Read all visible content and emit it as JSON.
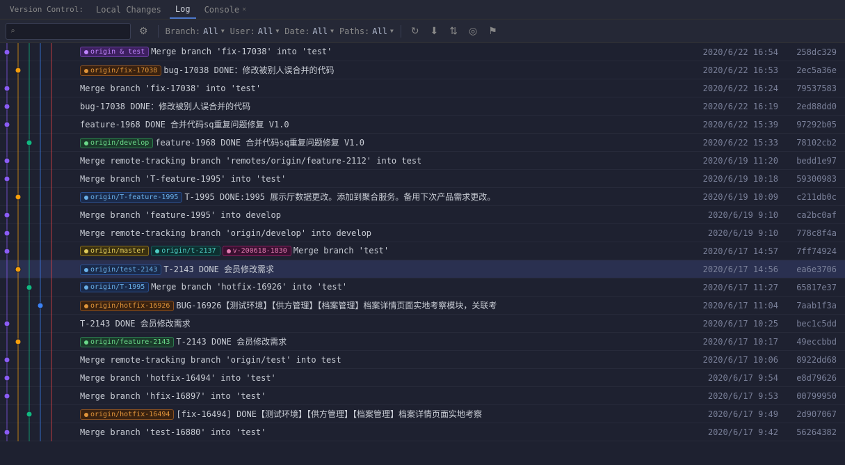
{
  "tabbar": {
    "version_control_label": "Version Control:",
    "local_changes_tab": "Local Changes",
    "log_tab": "Log",
    "console_tab": "Console"
  },
  "toolbar": {
    "search_placeholder": "⌕",
    "branch_label": "Branch:",
    "branch_value": "All",
    "user_label": "User:",
    "user_value": "All",
    "date_label": "Date:",
    "date_value": "All",
    "paths_label": "Paths:",
    "paths_value": "All"
  },
  "commits": [
    {
      "id": "258dc329",
      "date": "2020/6/22 16:54",
      "message": "Merge branch 'fix-17038' into 'test'",
      "tags": [
        {
          "label": "origin & test",
          "type": "purple"
        },
        {
          "label": "",
          "type": ""
        }
      ],
      "graph_col": 1,
      "selected": false
    },
    {
      "id": "2ec5a36e",
      "date": "2020/6/22 16:53",
      "message": "bug-17038 DONE：修改被别人误合并的代码",
      "tags": [
        {
          "label": "origin/fix-17038",
          "type": "orange"
        }
      ],
      "graph_col": 2,
      "selected": false
    },
    {
      "id": "79537583",
      "date": "2020/6/22 16:24",
      "message": "Merge branch 'fix-17038' into 'test'",
      "tags": [],
      "graph_col": 1,
      "selected": false
    },
    {
      "id": "2ed88dd0",
      "date": "2020/6/22 16:19",
      "message": "bug-17038 DONE：修改被别人误合并的代码",
      "tags": [],
      "graph_col": 1,
      "selected": false
    },
    {
      "id": "97292b05",
      "date": "2020/6/22 15:39",
      "message": "feature-1968 DONE  合并代码sq重复问题修复 V1.0",
      "tags": [],
      "graph_col": 1,
      "selected": false
    },
    {
      "id": "78102cb2",
      "date": "2020/6/22 15:33",
      "message": "feature-1968 DONE  合并代码sq重复问题修复 V1.0",
      "tags": [
        {
          "label": "origin/develop",
          "type": "green"
        }
      ],
      "graph_col": 3,
      "selected": false
    },
    {
      "id": "bedd1e97",
      "date": "2020/6/19 11:20",
      "message": "Merge remote-tracking branch 'remotes/origin/feature-2112' into test",
      "tags": [],
      "graph_col": 1,
      "selected": false
    },
    {
      "id": "59300983",
      "date": "2020/6/19 10:18",
      "message": "Merge branch 'T-feature-1995' into 'test'",
      "tags": [],
      "graph_col": 1,
      "selected": false
    },
    {
      "id": "c211db0c",
      "date": "2020/6/19 10:09",
      "message": "T-1995 DONE:1995 展示厅数据更改。添加到聚合服务。备用下次产品需求更改。",
      "tags": [
        {
          "label": "origin/T-feature-1995",
          "type": "blue"
        }
      ],
      "graph_col": 2,
      "selected": false
    },
    {
      "id": "ca2bc0af",
      "date": "2020/6/19 9:10",
      "message": "Merge branch 'feature-1995' into develop",
      "tags": [],
      "graph_col": 1,
      "selected": false
    },
    {
      "id": "778c8f4a",
      "date": "2020/6/19 9:10",
      "message": "Merge remote-tracking branch 'origin/develop' into develop",
      "tags": [],
      "graph_col": 1,
      "selected": false
    },
    {
      "id": "7ff74924",
      "date": "2020/6/17 14:57",
      "message": "Merge branch 'test'",
      "tags": [
        {
          "label": "origin/master",
          "type": "yellow"
        },
        {
          "label": "origin/t-2137",
          "type": "teal"
        },
        {
          "label": "v-200618-1830",
          "type": "pink"
        }
      ],
      "graph_col": 1,
      "selected": false
    },
    {
      "id": "ea6e3706",
      "date": "2020/6/17 14:56",
      "message": "T-2143 DONE 会员修改需求",
      "tags": [
        {
          "label": "origin/test-2143",
          "type": "blue"
        }
      ],
      "graph_col": 2,
      "selected": true
    },
    {
      "id": "65817e37",
      "date": "2020/6/17 11:27",
      "message": "Merge branch 'hotfix-16926' into 'test'",
      "tags": [
        {
          "label": "origin/T-1995",
          "type": "blue"
        }
      ],
      "graph_col": 3,
      "selected": false
    },
    {
      "id": "7aab1f3a",
      "date": "2020/6/17 11:04",
      "message": "BUG-16926【测试环境】【供方管理】【档案管理】档案详情页面实地考察模块，关联考",
      "tags": [
        {
          "label": "origin/hotfix-16926",
          "type": "orange"
        }
      ],
      "graph_col": 4,
      "selected": false
    },
    {
      "id": "bec1c5dd",
      "date": "2020/6/17 10:25",
      "message": "T-2143 DONE 会员修改需求",
      "tags": [],
      "graph_col": 1,
      "selected": false
    },
    {
      "id": "49eccbbd",
      "date": "2020/6/17 10:17",
      "message": "T-2143 DONE 会员修改需求",
      "tags": [
        {
          "label": "origin/feature-2143",
          "type": "green"
        }
      ],
      "graph_col": 2,
      "selected": false
    },
    {
      "id": "8922dd68",
      "date": "2020/6/17 10:06",
      "message": "Merge remote-tracking branch 'origin/test' into test",
      "tags": [],
      "graph_col": 1,
      "selected": false
    },
    {
      "id": "e8d79626",
      "date": "2020/6/17 9:54",
      "message": "Merge branch 'hotfix-16494' into 'test'",
      "tags": [],
      "graph_col": 1,
      "selected": false
    },
    {
      "id": "00799950",
      "date": "2020/6/17 9:53",
      "message": "Merge branch 'hfix-16897' into 'test'",
      "tags": [],
      "graph_col": 1,
      "selected": false
    },
    {
      "id": "2d907067",
      "date": "2020/6/17 9:49",
      "message": "[fix-16494] DONE【测试环境】【供方管理】【档案管理】档案详情页面实地考察",
      "tags": [
        {
          "label": "origin/hotfix-16494",
          "type": "orange"
        }
      ],
      "graph_col": 3,
      "selected": false
    },
    {
      "id": "56264382",
      "date": "2020/6/17 9:42",
      "message": "Merge branch 'test-16880' into 'test'",
      "tags": [],
      "graph_col": 1,
      "selected": false
    }
  ],
  "graph_colors": {
    "col1": "#8b5cf6",
    "col2": "#f59e0b",
    "col3": "#10b981",
    "col4": "#3b82f6",
    "col5": "#ef4444"
  }
}
